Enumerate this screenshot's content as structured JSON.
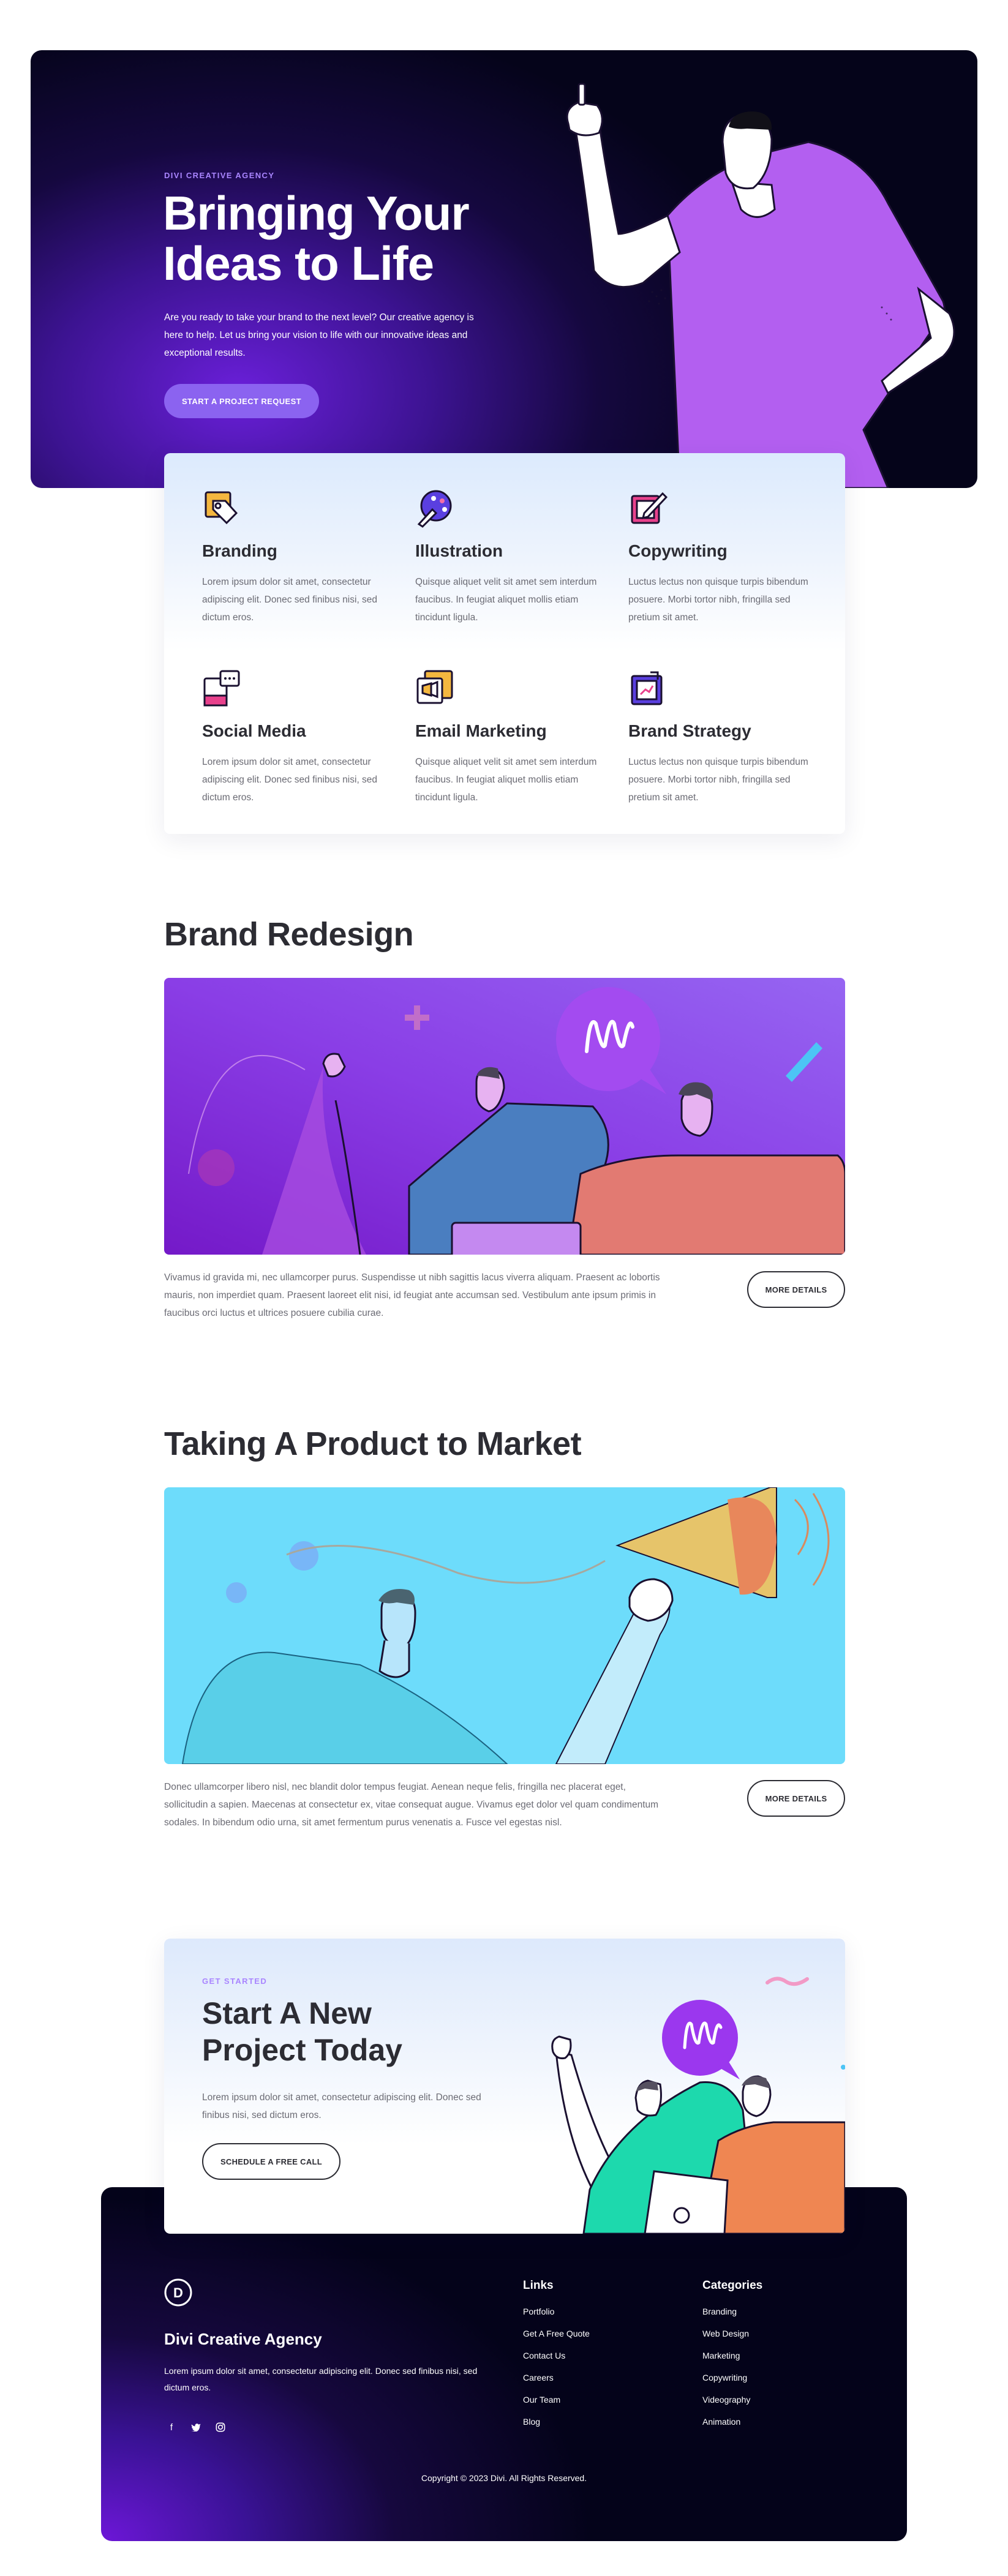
{
  "hero": {
    "eyebrow": "DIVI CREATIVE AGENCY",
    "title": "Bringing Your Ideas to Life",
    "text": "Are you ready to take your brand to the next level? Our creative agency is here to help. Let us bring your vision to life with our innovative ideas and exceptional results.",
    "cta_label": "START A PROJECT REQUEST"
  },
  "services": [
    {
      "title": "Branding",
      "desc": "Lorem ipsum dolor sit amet, consectetur adipiscing elit. Donec sed finibus nisi, sed dictum eros.",
      "icon": "branding-icon"
    },
    {
      "title": "Illustration",
      "desc": "Quisque aliquet velit sit amet sem interdum faucibus. In feugiat aliquet mollis etiam tincidunt ligula.",
      "icon": "palette-icon"
    },
    {
      "title": "Copywriting",
      "desc": "Luctus lectus non quisque turpis bibendum posuere. Morbi tortor nibh, fringilla sed pretium sit amet.",
      "icon": "edit-icon"
    },
    {
      "title": "Social Media",
      "desc": "Lorem ipsum dolor sit amet, consectetur adipiscing elit. Donec sed finibus nisi, sed dictum eros.",
      "icon": "social-media-icon"
    },
    {
      "title": "Email Marketing",
      "desc": "Quisque aliquet velit sit amet sem interdum faucibus. In feugiat aliquet mollis etiam tincidunt ligula.",
      "icon": "email-marketing-icon"
    },
    {
      "title": "Brand Strategy",
      "desc": "Luctus lectus non quisque turpis bibendum posuere. Morbi tortor nibh, fringilla sed pretium sit amet.",
      "icon": "strategy-icon"
    }
  ],
  "projects": [
    {
      "title": "Brand Redesign",
      "text": "Vivamus id gravida mi, nec ullamcorper purus. Suspendisse ut nibh sagittis lacus viverra aliquam. Praesent ac lobortis mauris, non imperdiet quam. Praesent laoreet elit nisi, id feugiat ante accumsan sed. Vestibulum ante ipsum primis in faucibus orci luctus et ultrices posuere cubilia curae.",
      "button": "MORE DETAILS"
    },
    {
      "title": "Taking A Product to Market",
      "text": "Donec ullamcorper libero nisl, nec blandit dolor tempus feugiat. Aenean neque felis, fringilla nec placerat eget, sollicitudin a sapien. Maecenas at consectetur ex, vitae consequat augue. Vivamus eget dolor vel quam condimentum sodales. In bibendum odio urna, sit amet fermentum purus venenatis a. Fusce vel egestas nisl.",
      "button": "MORE DETAILS"
    }
  ],
  "cta": {
    "eyebrow": "GET STARTED",
    "title": "Start A New Project Today",
    "text": "Lorem ipsum dolor sit amet, consectetur adipiscing elit. Donec sed finibus nisi, sed dictum eros.",
    "button": "SCHEDULE A FREE CALL"
  },
  "footer": {
    "logo_letter": "D",
    "name": "Divi Creative Agency",
    "desc": "Lorem ipsum dolor sit amet, consectetur adipiscing elit. Donec sed finibus nisi, sed dictum eros.",
    "social": [
      {
        "glyph": "f",
        "icon": "facebook-icon"
      },
      {
        "glyph": "🐦",
        "icon": "twitter-icon"
      },
      {
        "glyph": "◎",
        "icon": "instagram-icon"
      }
    ],
    "links_title": "Links",
    "links": [
      "Portfolio",
      "Get A Free Quote",
      "Contact Us",
      "Careers",
      "Our Team",
      "Blog"
    ],
    "categories_title": "Categories",
    "categories": [
      "Branding",
      "Web Design",
      "Marketing",
      "Copywriting",
      "Videography",
      "Animation"
    ],
    "copyright": "Copyright © 2023 Divi. All Rights Reserved."
  },
  "colors": {
    "accent": "#8b63f0",
    "eyebrow": "#a985ff",
    "heading": "#2c2c33",
    "body": "#6b6b74",
    "hero_dark": "#05041a",
    "hero_purple": "#6a1fd9"
  }
}
